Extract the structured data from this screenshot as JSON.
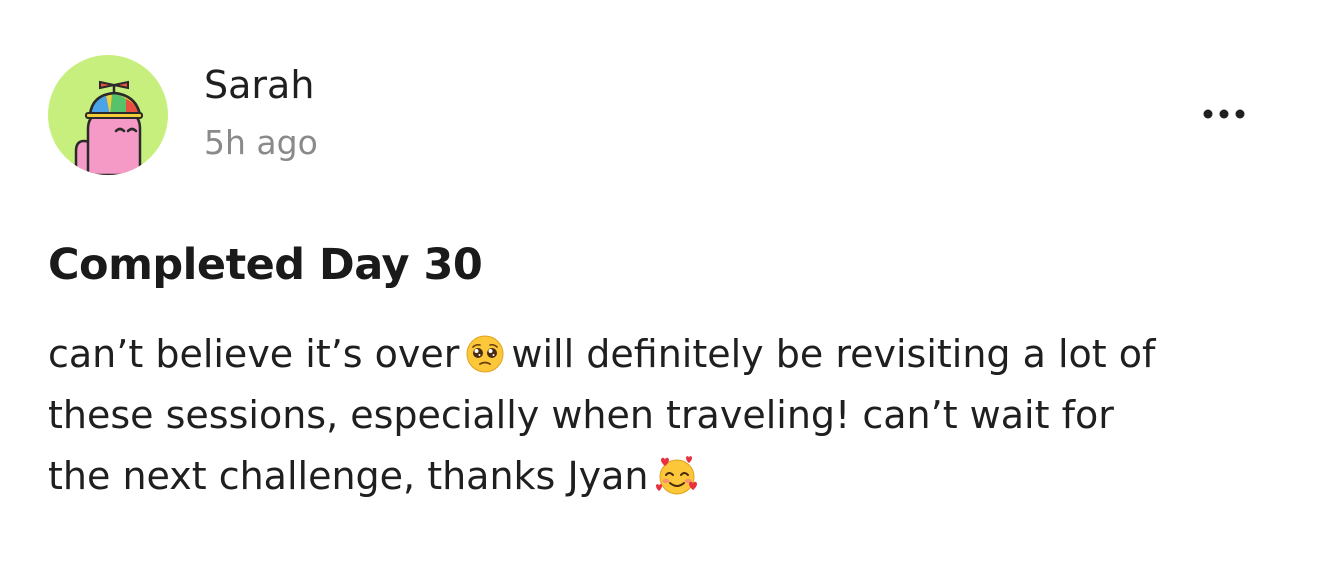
{
  "post": {
    "author": {
      "name": "Sarah",
      "avatar_icon": "propeller-cap-character-avatar",
      "avatar_bg_color": "#c6ef7e"
    },
    "timestamp": "5h ago",
    "more_menu_icon": "ellipsis-horizontal-icon",
    "title": "Completed Day 30",
    "body": {
      "line1_before_emoji": "can’t believe it’s over",
      "emoji_1": "pleading-face-emoji",
      "line1_after_emoji": "will definitely be revisiting a lot of",
      "line2": "these sessions, especially when traveling! can’t wait for",
      "line3_before_emoji": "the next challenge, thanks Jyan",
      "emoji_2": "smiling-face-with-hearts-emoji"
    }
  }
}
